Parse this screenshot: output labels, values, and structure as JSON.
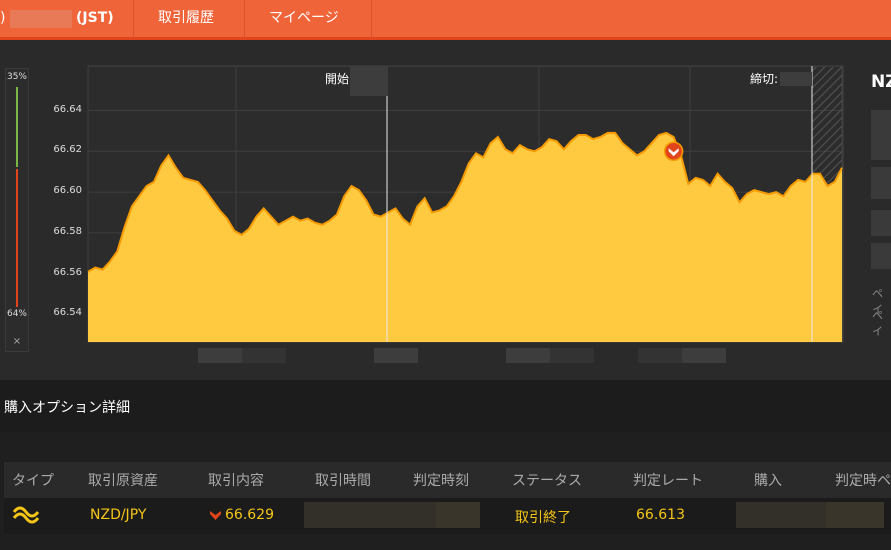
{
  "topnav": {
    "timezone_label": "(JST)",
    "history_tab": "取引履歴",
    "mypage_tab": "マイページ"
  },
  "chart": {
    "start_label": "開始",
    "close_label": "締切:",
    "ratio_high_label": "35%",
    "ratio_low_label": "64%",
    "ratio_close_label": "×",
    "y_ticks": [
      "66.64",
      "66.62",
      "66.60",
      "66.58",
      "66.56",
      "66.54"
    ]
  },
  "chart_data": {
    "type": "area",
    "ylim": [
      66.53,
      66.65
    ],
    "y_ticks": [
      "66.64",
      "66.62",
      "66.60",
      "66.58",
      "66.56",
      "66.54"
    ],
    "series": [
      {
        "values": [
          66.561,
          66.563,
          66.562,
          66.566,
          66.571,
          66.583,
          66.593,
          66.598,
          66.603,
          66.605,
          66.613,
          66.618,
          66.612,
          66.607,
          66.606,
          66.605,
          66.601,
          66.596,
          66.591,
          66.587,
          66.581,
          66.579,
          66.582,
          66.588,
          66.592,
          66.588,
          66.584,
          66.586,
          66.588,
          66.586,
          66.587,
          66.585,
          66.584,
          66.586,
          66.589,
          66.598,
          66.603,
          66.601,
          66.596,
          66.589,
          66.588,
          66.59,
          66.592,
          66.587,
          66.584,
          66.593,
          66.597,
          66.59,
          66.591,
          66.593,
          66.598,
          66.605,
          66.614,
          66.619,
          66.617,
          66.624,
          66.627,
          66.621,
          66.619,
          66.623,
          66.621,
          66.62,
          66.622,
          66.626,
          66.625,
          66.621,
          66.625,
          66.628,
          66.628,
          66.626,
          66.627,
          66.629,
          66.629,
          66.624,
          66.621,
          66.618,
          66.62,
          66.624,
          66.628,
          66.629,
          66.627,
          66.618,
          66.604,
          66.607,
          66.606,
          66.603,
          66.609,
          66.605,
          66.602,
          66.595,
          66.599,
          66.601,
          66.6,
          66.599,
          66.6,
          66.598,
          66.603,
          66.606,
          66.605,
          66.609,
          66.609,
          66.603,
          66.605,
          66.612
        ]
      }
    ],
    "marker": {
      "index": 80,
      "value": 66.62
    }
  },
  "right_panel": {
    "pair_label": "NZ",
    "pay_label_1": "ペイ",
    "pay_label_2": "ペイ"
  },
  "details": {
    "title": "購入オプション詳細",
    "columns": [
      "タイプ",
      "取引原資産",
      "取引内容",
      "取引時間",
      "判定時刻",
      "ステータス",
      "判定レート",
      "購入",
      "判定時ペ"
    ],
    "row": {
      "asset": "NZD/JPY",
      "direction_icon": "down-arrow-icon",
      "trade_rate": "66.629",
      "status": "取引終了",
      "judge_rate": "66.613"
    }
  },
  "colors": {
    "accent": "#f0643a",
    "area_fill": "#ffc940",
    "area_line": "#f59a00",
    "marker": "#e2451b",
    "highlight_text": "#f5c518"
  }
}
